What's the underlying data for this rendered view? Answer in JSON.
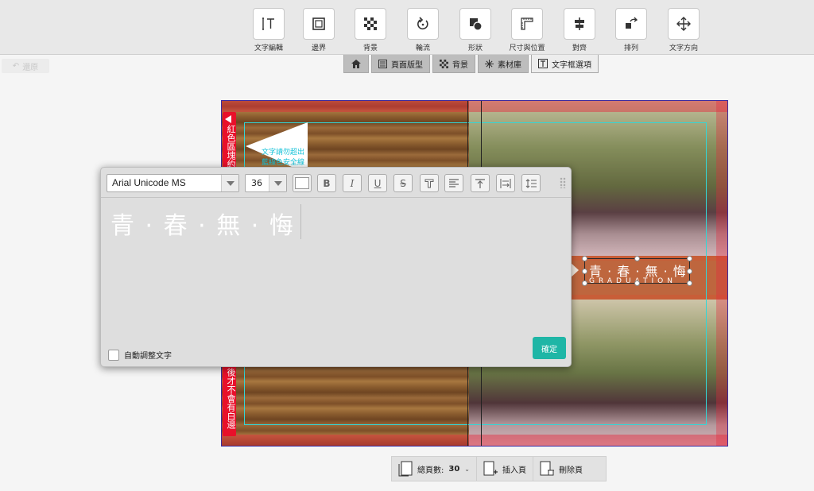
{
  "toolbar": {
    "tools": [
      {
        "label": "文字編輯",
        "icon": "text-edit-icon"
      },
      {
        "label": "邊界",
        "icon": "border-icon"
      },
      {
        "label": "背景",
        "icon": "background-checker-icon"
      },
      {
        "label": "輪流",
        "icon": "rotate-icon"
      },
      {
        "label": "形狀",
        "icon": "shape-icon"
      },
      {
        "label": "尺寸與位置",
        "icon": "ruler-icon"
      },
      {
        "label": "對齊",
        "icon": "align-icon"
      },
      {
        "label": "排列",
        "icon": "arrange-icon"
      },
      {
        "label": "文字方向",
        "icon": "move-arrows-icon"
      }
    ],
    "undo_label": "還原"
  },
  "tabs": [
    {
      "label": "",
      "icon": "home-icon"
    },
    {
      "label": "頁面版型",
      "icon": "layout-icon"
    },
    {
      "label": "背景",
      "icon": "background-checker-icon"
    },
    {
      "label": "素材庫",
      "icon": "sparkle-icon"
    },
    {
      "label": "文字框選項",
      "icon": "textbox-icon"
    }
  ],
  "canvas": {
    "red_tab_text": "紅色區塊約",
    "red_tab_text_bottom": "後才不會有白邊",
    "callout_lines": [
      "文字請勿超出",
      "藍線色安全線"
    ],
    "title_main": "青 · 春 · 無 · 悔",
    "title_sub": "GRADUATION"
  },
  "editor": {
    "font": "Arial Unicode MS",
    "size": "36",
    "text": "青 · 春 · 無 · 悔",
    "auto_fit_label": "自動調整文字",
    "auto_fit_checked": false,
    "confirm_label": "確定",
    "buttons": [
      "B",
      "I",
      "U",
      "S"
    ]
  },
  "bottom_bar": {
    "total_pages_label": "總頁數:",
    "total_pages": "30",
    "insert_label": "插入頁",
    "delete_label": "刪除頁"
  },
  "colors": {
    "accent": "#1fb6a6",
    "red_tab": "#e8102a",
    "safe_guide": "#33d6d6"
  }
}
